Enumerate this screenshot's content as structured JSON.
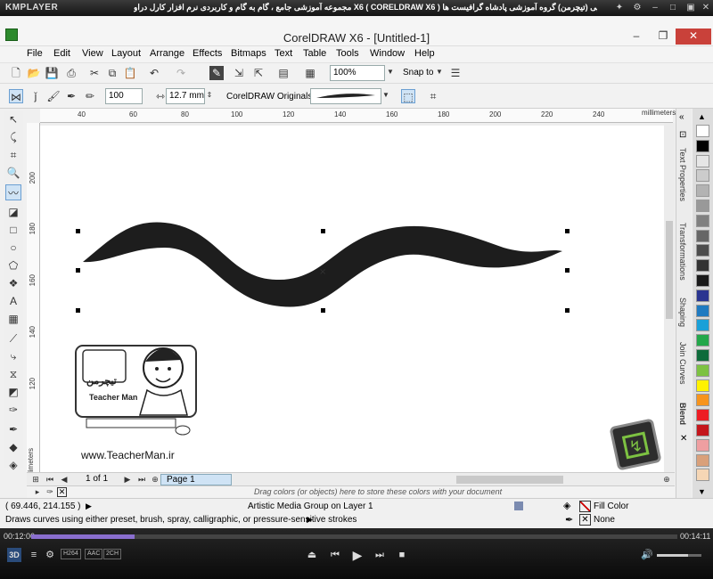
{
  "player": {
    "logo": "KMPLAYER",
    "title": "مجموعه آموزشی جامع ، گام به گام و کاربردی نرم افزار کارل دراو  X6 ( CORELDRAW X6 )  مدرس : سعید هدایی (تیچرمن) گروه آموزشی پادشاه گرافیست ها",
    "time_elapsed": "00:12:06",
    "time_total": "00:14:11",
    "progress": 0.16,
    "tags": [
      "H264",
      "AAC",
      "2CH"
    ]
  },
  "app": {
    "title": "CorelDRAW X6 - [Untitled-1]",
    "menu": [
      "File",
      "Edit",
      "View",
      "Layout",
      "Arrange",
      "Effects",
      "Bitmaps",
      "Text",
      "Table",
      "Tools",
      "Window",
      "Help"
    ],
    "zoom": "100%",
    "snap_to": "Snap to",
    "brush_size_value": "100",
    "stroke_width": "12.7 mm",
    "preset_category": "CorelDRAW Originals"
  },
  "rulers": {
    "h_ticks": [
      "40",
      "60",
      "80",
      "100",
      "120",
      "140",
      "160",
      "180",
      "200",
      "220",
      "240"
    ],
    "v_ticks": [
      "200",
      "180",
      "160",
      "140",
      "120"
    ],
    "unit": "millimeters"
  },
  "watermark": {
    "logo_text": "تیچرمن",
    "brand": "Teacher Man",
    "url": "www.TeacherMan.ir"
  },
  "page_nav": {
    "page_count": "1 of 1",
    "page_tab": "Page 1"
  },
  "palette_hint": "Drag colors (or objects) here to store these colors with your document",
  "dockers": [
    "Text Properties",
    "Transformations",
    "Shaping",
    "Join Curves",
    "Blend"
  ],
  "palette_colors": [
    "#ffffff",
    "#000000",
    "#e6e6e6",
    "#cccccc",
    "#b3b3b3",
    "#999999",
    "#808080",
    "#666666",
    "#4d4d4d",
    "#333333",
    "#1a1a1a",
    "#2a3590",
    "#1f7ac0",
    "#19a0d8",
    "#23a74a",
    "#0e6b3b",
    "#7dc242",
    "#fff200",
    "#f7941d",
    "#ed1c24",
    "#c4161c",
    "#ef9fa1",
    "#d9a07a",
    "#f5d6b5"
  ],
  "status": {
    "coords": "( 69.446, 214.155 )",
    "object_info": "Artistic Media Group on Layer 1",
    "fill": "Fill Color",
    "outline": "None",
    "hint": "Draws curves using either preset, brush, spray, calligraphic, or pressure-sensitive strokes"
  },
  "colors": {
    "accent": "#2d8a2d",
    "selection": "#cfe3f5",
    "close": "#c9413a"
  }
}
